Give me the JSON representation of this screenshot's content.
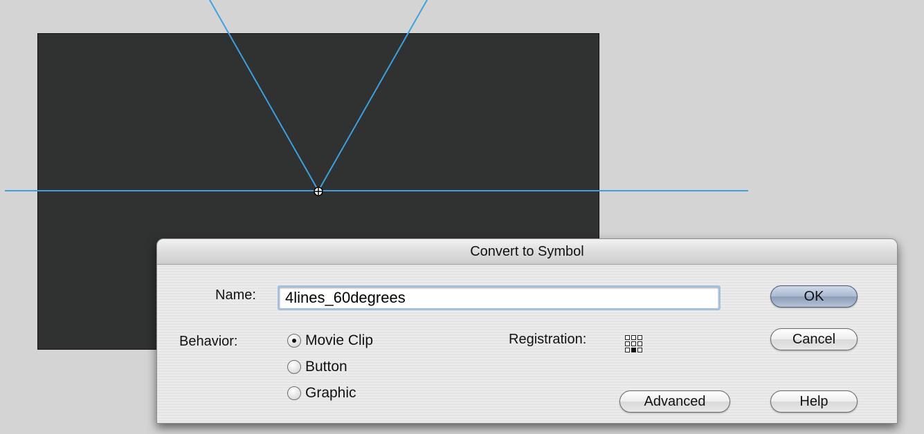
{
  "dialog": {
    "title": "Convert to Symbol",
    "name_label": "Name:",
    "name_value": "4lines_60degrees",
    "behavior_label": "Behavior:",
    "behavior_options": [
      {
        "label": "Movie Clip",
        "checked": true
      },
      {
        "label": "Button",
        "checked": false
      },
      {
        "label": "Graphic",
        "checked": false
      }
    ],
    "registration_label": "Registration:",
    "registration_selected": "bottom-center",
    "buttons": {
      "ok": "OK",
      "cancel": "Cancel",
      "advanced": "Advanced",
      "help": "Help"
    }
  },
  "colors": {
    "stage": "#303131",
    "workspace": "#d4d4d4",
    "guide": "#3ea0e0",
    "ok_button": "#a9b8cf"
  }
}
